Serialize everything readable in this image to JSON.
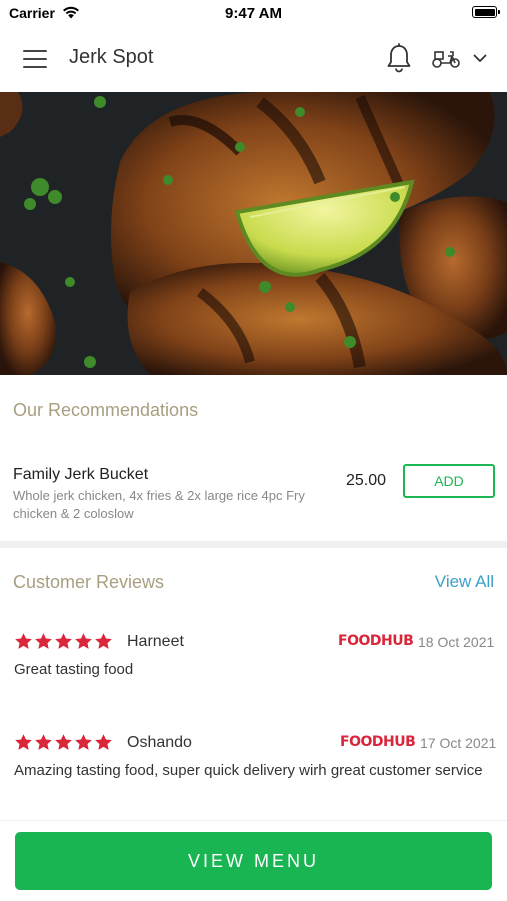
{
  "status_bar": {
    "carrier": "Carrier",
    "time": "9:47 AM"
  },
  "header": {
    "title": "Jerk Spot",
    "icons": [
      "menu-icon",
      "bell-icon",
      "delivery-scooter-icon",
      "chevron-down-icon"
    ]
  },
  "recommendations": {
    "title": "Our Recommendations",
    "items": [
      {
        "name": "Family Jerk Bucket",
        "description": "Whole jerk chicken, 4x fries & 2x large rice 4pc Fry chicken & 2 coloslow",
        "price": "25.00",
        "add_label": "ADD"
      }
    ]
  },
  "reviews": {
    "title": "Customer Reviews",
    "view_all_label": "View All",
    "items": [
      {
        "rating": 5,
        "name": "Harneet",
        "source": "FOODHUB",
        "date": "18 Oct 2021",
        "text": "Great tasting food"
      },
      {
        "rating": 5,
        "name": "Oshando",
        "source": "FOODHUB",
        "date": "17 Oct 2021",
        "text": "Amazing tasting food, super quick delivery wirh great customer service"
      }
    ]
  },
  "bottom": {
    "view_menu_label": "VIEW MENU"
  },
  "colors": {
    "accent_green": "#19b552",
    "section_title": "#a89e80",
    "link_blue": "#3ba0c8",
    "star_red": "#d9263a"
  }
}
